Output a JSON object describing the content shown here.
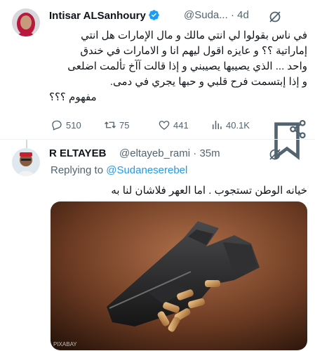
{
  "tweet1": {
    "author_name": "Intisar ALSanhoury",
    "handle": "@Suda...",
    "separator": "·",
    "time": "4d",
    "lines": [
      "في ناس بقولوا لي انتي مالك و مال الإمارات هل انتي",
      "إماراتية ؟؟ و عايزه اقول ليهم انا و الامارات في خندق",
      "واحد ... الذي يصيبها يصيبني و إذا قالت آآخ تألمت اضلعى",
      "و إذا إبتسمت فرح قلبي و حبها يجري في دمى.",
      "مفهوم ؟؟؟"
    ],
    "replies": "510",
    "retweets": "75",
    "likes": "441",
    "views": "40.1K"
  },
  "tweet2": {
    "author_name": "R ELTAYEB",
    "handle": "@eltayeb_rami",
    "separator": "·",
    "time": "35m",
    "replying_prefix": "Replying to",
    "replying_handle": "@Sudaneserebel",
    "text": "خيانه الوطن تستجوب . اما العهر فلاشان لنا به",
    "image_watermark": "PIXABAY"
  },
  "colors": {
    "accent": "#1d9bf0",
    "muted": "#536471",
    "divider": "#eff3f4"
  },
  "icons": [
    "verified-badge-icon",
    "grok-icon",
    "reply-icon",
    "retweet-icon",
    "like-icon",
    "views-icon",
    "bookmark-icon",
    "share-icon"
  ]
}
